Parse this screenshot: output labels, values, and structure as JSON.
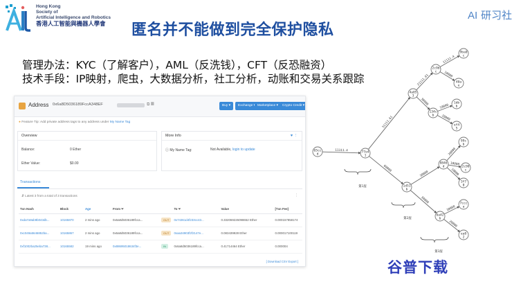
{
  "header": {
    "org_en": [
      "Hong Kong",
      "Society of",
      "Artificial Intelligence and Robotics"
    ],
    "org_zh": "香港人工智能與機器人學會",
    "title": "匿名并不能做到完全保护隐私",
    "brand": "AI 研习社",
    "brand_ai": "AI",
    "brand_cn": "研习社"
  },
  "body": {
    "line1": "管理办法：KYC（了解客户），AML（反洗钱），CFT（反恐融资）",
    "line2": "技术手段：IP映射，爬虫，大数据分析，社工分析，动账和交易关系跟踪"
  },
  "screenshot": {
    "address_label": "Address",
    "address_hash": "0x6a8D5036189FccA348EF",
    "buttons": [
      "Buy ▾",
      "Exchange ▾",
      "Marketplace ▾",
      "Crypto Credit ▾"
    ],
    "tip_prefix": "Feature Tip:",
    "tip_text": "Add private address tags to any address under",
    "tip_link": "My Name Tag",
    "overview": {
      "title": "Overview",
      "rows": [
        {
          "k": "Balance:",
          "v": "0 Ether"
        },
        {
          "k": "Ether Value:",
          "v": "$0.00"
        }
      ]
    },
    "more_info": {
      "title": "More Info",
      "name_tag_label": "My Name Tag:",
      "name_tag_value": "Not Available,",
      "name_tag_link": "login to update"
    },
    "tab_label": "Transactions",
    "latest_text": "Latest 3 from a total of 3 transactions",
    "columns": [
      "Txn Hash",
      "Block",
      "Age",
      "From",
      "",
      "To",
      "Value",
      "[Txn Fee]"
    ],
    "rows": [
      {
        "hash": "0xda7a9ab9b043db...",
        "block": "10165870",
        "age": "2 mins ago",
        "from": "0x6a8d5036189fcca...",
        "dir": "OUT",
        "to": "0x74361d4f233cc43...",
        "value": "0.332069226098652 Ether",
        "fee": "0.000157858174"
      },
      {
        "hash": "0xc049a5646852ba...",
        "block": "10165867",
        "age": "2 mins ago",
        "from": "0x6a8d5036189fcca...",
        "dir": "OUT",
        "to": "0xaa34903f2f2147e...",
        "value": "0.083439928 Ether",
        "fee": "0.000017100119"
      },
      {
        "hash": "0xf1002ba25eba738...",
        "block": "10165582",
        "age": "19 mins ago",
        "from": "0x88695018634f3e...",
        "dir": "IN",
        "to": "0x6a8d5036189fcca...",
        "value": "0.41714464 Ether",
        "fee": "0.000004"
      }
    ],
    "csv_link": "[ Download CSV Export ]"
  },
  "graph": {
    "nodes": [
      {
        "id": "n0",
        "l1": "65cc",
        "l2": "d"
      },
      {
        "id": "n1",
        "l1": "77e4",
        "l2": "1"
      },
      {
        "id": "n2",
        "l1": "4a85",
        "l2": "3"
      },
      {
        "id": "n3",
        "l1": "2c9b",
        "l2": "c"
      },
      {
        "id": "n4",
        "l1": "9ba0",
        "l2": "c"
      },
      {
        "id": "n5",
        "l1": "40a",
        "l2": "e"
      },
      {
        "id": "n6",
        "l1": "134c",
        "l2": "b"
      },
      {
        "id": "n7",
        "l1": "1db",
        "l2": "b"
      },
      {
        "id": "n8",
        "l1": "ef4",
        "l2": "5"
      },
      {
        "id": "n9",
        "l1": "1d51",
        "l2": "b"
      },
      {
        "id": "n10",
        "l1": "8846",
        "l2": "d"
      },
      {
        "id": "n11",
        "l1": "99c",
        "l2": "b"
      },
      {
        "id": "n12",
        "l1": "2c90",
        "l2": "c"
      },
      {
        "id": "n13",
        "l1": "3f7",
        "l2": "0"
      },
      {
        "id": "n14",
        "l1": "6a42",
        "l2": "b"
      },
      {
        "id": "n15",
        "l1": "7ccc",
        "l2": "a"
      },
      {
        "id": "n16",
        "l1": "ea8",
        "l2": "2"
      }
    ],
    "edges": [
      {
        "from": "n0",
        "to": "n1",
        "label": "11111.4"
      },
      {
        "from": "n1",
        "to": "n2",
        "label": "51111.61"
      },
      {
        "from": "n1",
        "to": "n9",
        "label": "60000"
      },
      {
        "from": "n2",
        "to": "n3",
        "label": "21111.61"
      },
      {
        "from": "n2",
        "to": "n6",
        "label": "30000"
      },
      {
        "from": "n3",
        "to": "n4",
        "label": "11111.4"
      },
      {
        "from": "n3",
        "to": "n5",
        "label": "10000"
      },
      {
        "from": "n6",
        "to": "n7",
        "label": "10000"
      },
      {
        "from": "n6",
        "to": "n8",
        "label": "20000"
      },
      {
        "from": "n9",
        "to": "n10",
        "label": "30000"
      },
      {
        "from": "n9",
        "to": "n14",
        "label": "30000"
      },
      {
        "from": "n10",
        "to": "n11",
        "label": "20000"
      },
      {
        "from": "n10",
        "to": "n12",
        "label": "10000"
      },
      {
        "from": "n10",
        "to": "n13",
        "label": "10000"
      },
      {
        "from": "n14",
        "to": "n15",
        "label": "10000"
      },
      {
        "from": "n14",
        "to": "n16",
        "label": "20000"
      }
    ],
    "levels": [
      "第1层",
      "第2层",
      "第3层"
    ]
  },
  "watermark": "谷普下载",
  "colors": {
    "title_blue": "#1f4fa0",
    "brand_blue": "#4f84c6",
    "link_blue": "#3a8ad8",
    "watermark_blue": "#2e3eb8"
  }
}
